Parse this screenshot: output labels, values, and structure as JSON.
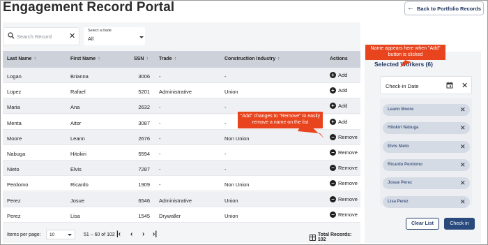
{
  "header": {
    "title": "Engagement Record Portal",
    "back_label": "Back to Portfolio Records"
  },
  "search": {
    "placeholder": "Search Record"
  },
  "trade_filter": {
    "label": "Select a trade",
    "value": "All"
  },
  "table": {
    "columns": [
      "Last Name",
      "First Name",
      "SSN",
      "Trade",
      "Construction Industry",
      "Actions"
    ],
    "rows": [
      {
        "last": "Logan",
        "first": "Brianna",
        "ssn": "3006",
        "trade": "-",
        "industry": "-",
        "action": "Add"
      },
      {
        "last": "Lopez",
        "first": "Rafael",
        "ssn": "5201",
        "trade": "Administrative",
        "industry": "Union",
        "action": "Add"
      },
      {
        "last": "Maria",
        "first": "Ana",
        "ssn": "2632",
        "trade": "-",
        "industry": "-",
        "action": "Add"
      },
      {
        "last": "Menta",
        "first": "Aitor",
        "ssn": "3087",
        "trade": "-",
        "industry": "-",
        "action": "Add"
      },
      {
        "last": "Moore",
        "first": "Leann",
        "ssn": "2676",
        "trade": "-",
        "industry": "Non Union",
        "action": "Remove"
      },
      {
        "last": "Nabuga",
        "first": "Hitokiri",
        "ssn": "5594",
        "trade": "-",
        "industry": "-",
        "action": "Remove"
      },
      {
        "last": "Nieto",
        "first": "Elvis",
        "ssn": "7287",
        "trade": "-",
        "industry": "-",
        "action": "Remove"
      },
      {
        "last": "Perdomo",
        "first": "Ricardo",
        "ssn": "1909",
        "trade": "-",
        "industry": "Non Union",
        "action": "Remove"
      },
      {
        "last": "Perez",
        "first": "Josue",
        "ssn": "6546",
        "trade": "Administrative",
        "industry": "Union",
        "action": "Remove"
      },
      {
        "last": "Perez",
        "first": "Lisa",
        "ssn": "1545",
        "trade": "Drywaller",
        "industry": "Union",
        "action": "Remove"
      }
    ]
  },
  "pagination": {
    "items_label": "Items per page:",
    "per_page": "10",
    "range": "51 – 60 of 102",
    "total": "Total Records: 102"
  },
  "selected": {
    "title": "Selected Workers (6)",
    "checkin_placeholder": "Check-in Date",
    "workers": [
      "Leann Moore",
      "Hitokiri Nabuga",
      "Elvis Nieto",
      "Ricardo Perdomo",
      "Josue Perez",
      "Lisa Perez"
    ],
    "clear_label": "Clear List",
    "checkin_label": "Check in"
  },
  "annotations": {
    "add_note": "Name appears here when \"Add\" button is clicked",
    "remove_note": "\"Add\" changes to \"Remove\" to easily remove a name on the list"
  },
  "colors": {
    "accent": "#2a4a7e",
    "callout": "#e8441d",
    "header_bg": "#cdd1d9"
  }
}
